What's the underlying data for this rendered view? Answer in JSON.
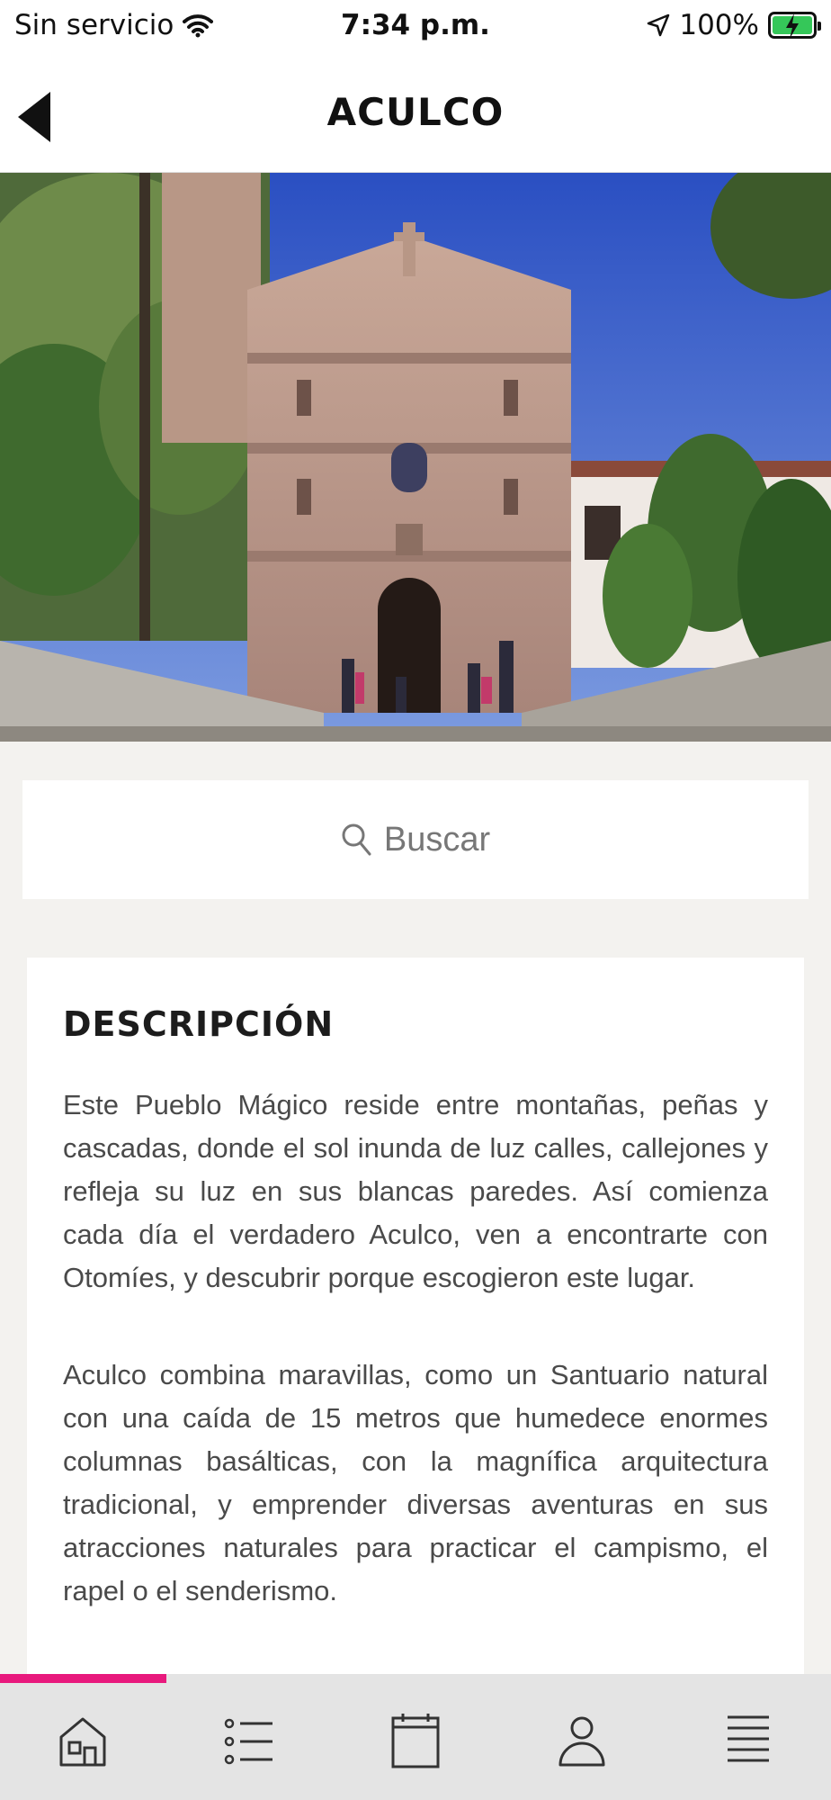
{
  "status_bar": {
    "carrier": "Sin servicio",
    "time": "7:34 p.m.",
    "battery": "100%"
  },
  "header": {
    "title": "ACULCO",
    "back_icon": "back-arrow-icon"
  },
  "hero": {
    "icon": "church-photo"
  },
  "search": {
    "placeholder": "Buscar",
    "icon": "search-icon"
  },
  "description": {
    "title": "DESCRIPCIÓN",
    "paragraphs": [
      "Este Pueblo Mágico reside entre montañas, peñas y cascadas, donde el sol inunda de luz calles, callejones y refleja su luz en sus blancas paredes. Así comienza cada día el verdadero Aculco, ven a encontrarte con Otomíes, y descubrir porque escogieron este lugar.",
      "Aculco combina maravillas, como un Santuario natural con una caída de 15 metros que humedece enormes columnas basálticas, con la magnífica arquitectura tradicional, y emprender diversas aventuras en sus atracciones naturales para practicar el campismo, el rapel o el senderismo."
    ]
  },
  "tabbar": {
    "active_color": "#e8197d",
    "items": [
      {
        "icon": "home-icon"
      },
      {
        "icon": "list-icon"
      },
      {
        "icon": "calendar-icon"
      },
      {
        "icon": "profile-icon"
      },
      {
        "icon": "menu-icon"
      }
    ]
  }
}
